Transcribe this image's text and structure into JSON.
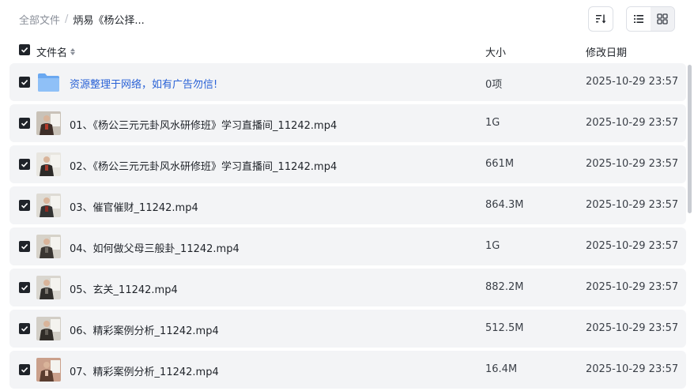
{
  "breadcrumb": {
    "root": "全部文件",
    "separator": "/",
    "current": "炳易《杨公择..."
  },
  "toolbar": {
    "sort_icon": "sort-icon",
    "list_view_icon": "list-view-icon",
    "grid_view_icon": "grid-view-icon"
  },
  "columns": {
    "name": "文件名",
    "size": "大小",
    "date": "修改日期"
  },
  "colors": {
    "folder_link": "#2a62d6",
    "row_bg": "#f3f4f6",
    "checkbox": "#1f2329"
  },
  "files": [
    {
      "kind": "folder",
      "name": "资源整理于网络，如有广告勿信!",
      "size": "0项",
      "date": "2025-10-29 23:57"
    },
    {
      "kind": "video",
      "name": "01、《杨公三元元卦风水研修班》学习直播间_11242.mp4",
      "size": "1G",
      "date": "2025-10-29 23:57"
    },
    {
      "kind": "video",
      "name": "02、《杨公三元元卦风水研修班》学习直播间_11242.mp4",
      "size": "661M",
      "date": "2025-10-29 23:57"
    },
    {
      "kind": "video",
      "name": "03、催官催财_11242.mp4",
      "size": "864.3M",
      "date": "2025-10-29 23:57"
    },
    {
      "kind": "video",
      "name": "04、如何做父母三般卦_11242.mp4",
      "size": "1G",
      "date": "2025-10-29 23:57"
    },
    {
      "kind": "video",
      "name": "05、玄关_11242.mp4",
      "size": "882.2M",
      "date": "2025-10-29 23:57"
    },
    {
      "kind": "video",
      "name": "06、精彩案例分析_11242.mp4",
      "size": "512.5M",
      "date": "2025-10-29 23:57"
    },
    {
      "kind": "video",
      "name": "07、精彩案例分析_11242.mp4",
      "size": "16.4M",
      "date": "2025-10-29 23:57"
    }
  ]
}
